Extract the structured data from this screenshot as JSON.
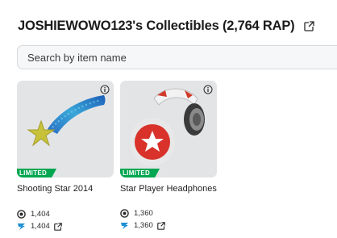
{
  "header": {
    "title": "JOSHIEWOWO123's Collectibles (2,764 RAP)",
    "link_icon": "external-link-icon"
  },
  "search": {
    "placeholder": "Search by item name",
    "value": ""
  },
  "items": [
    {
      "name": "Shooting Star 2014",
      "badge": "LIMITED",
      "rap": "1,404",
      "price": "1,404",
      "icons": [
        "info-icon",
        "rap-icon",
        "robux-icon",
        "external-link-icon"
      ]
    },
    {
      "name": "Star Player Headphones",
      "badge": "LIMITED",
      "rap": "1,360",
      "price": "1,360",
      "icons": [
        "info-icon",
        "rap-icon",
        "robux-icon",
        "external-link-icon"
      ]
    }
  ],
  "colors": {
    "limited_badge": "#00a650",
    "robux_icon": "#1f8fd6",
    "thumb_bg": "#e3e4e6"
  }
}
